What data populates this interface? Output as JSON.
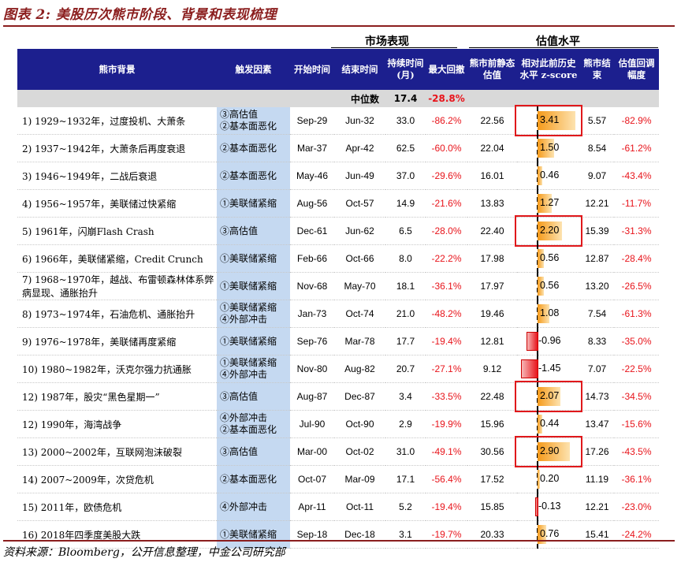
{
  "title": "图表 2: 美股历次熊市阶段、背景和表现梳理",
  "group_headers": {
    "market": "市场表现",
    "valuation": "估值水平"
  },
  "headers": [
    "熊市背景",
    "触发因素",
    "开始时间",
    "结束时间",
    "持续时间(月)",
    "最大回撤",
    "熊市前静态估值",
    "相对此前历史水平 z-score",
    "熊市结束",
    "估值回调幅度"
  ],
  "median": {
    "label": "中位数",
    "duration": "17.4",
    "drawdown": "-28.8%"
  },
  "rows": [
    {
      "bg": "1) 1929~1932年，过度投机、大萧条",
      "trigger": [
        "③高估值",
        "②基本面恶化"
      ],
      "start": "Sep-29",
      "end": "Jun-32",
      "dur": "33.0",
      "dd": "-86.2%",
      "pe_before": "22.56",
      "z": "3.41",
      "pe_end": "5.57",
      "pe_chg": "-82.9%",
      "z_value": 3.41,
      "highlight": true
    },
    {
      "bg": "2) 1937~1942年，大萧条后再度衰退",
      "trigger": [
        "②基本面恶化"
      ],
      "start": "Mar-37",
      "end": "Apr-42",
      "dur": "62.5",
      "dd": "-60.0%",
      "pe_before": "22.04",
      "z": "1.50",
      "pe_end": "8.54",
      "pe_chg": "-61.2%",
      "z_value": 1.5,
      "highlight": false
    },
    {
      "bg": "3) 1946~1949年，二战后衰退",
      "trigger": [
        "②基本面恶化"
      ],
      "start": "May-46",
      "end": "Jun-49",
      "dur": "37.0",
      "dd": "-29.6%",
      "pe_before": "16.01",
      "z": "0.46",
      "pe_end": "9.07",
      "pe_chg": "-43.4%",
      "z_value": 0.46,
      "highlight": false
    },
    {
      "bg": "4) 1956~1957年，美联储过快紧缩",
      "trigger": [
        "①美联储紧缩"
      ],
      "start": "Aug-56",
      "end": "Oct-57",
      "dur": "14.9",
      "dd": "-21.6%",
      "pe_before": "13.83",
      "z": "1.27",
      "pe_end": "12.21",
      "pe_chg": "-11.7%",
      "z_value": 1.27,
      "highlight": false
    },
    {
      "bg": "5) 1961年，闪崩Flash Crash",
      "trigger": [
        "③高估值"
      ],
      "start": "Dec-61",
      "end": "Jun-62",
      "dur": "6.5",
      "dd": "-28.0%",
      "pe_before": "22.40",
      "z": "2.20",
      "pe_end": "15.39",
      "pe_chg": "-31.3%",
      "z_value": 2.2,
      "highlight": true
    },
    {
      "bg": "6) 1966年，美联储紧缩，Credit Crunch",
      "trigger": [
        "①美联储紧缩"
      ],
      "start": "Feb-66",
      "end": "Oct-66",
      "dur": "8.0",
      "dd": "-22.2%",
      "pe_before": "17.98",
      "z": "0.56",
      "pe_end": "12.87",
      "pe_chg": "-28.4%",
      "z_value": 0.56,
      "highlight": false
    },
    {
      "bg": "7) 1968~1970年，越战、布雷顿森林体系弊病显现、通胀抬升",
      "trigger": [
        "①美联储紧缩"
      ],
      "start": "Nov-68",
      "end": "May-70",
      "dur": "18.1",
      "dd": "-36.1%",
      "pe_before": "17.97",
      "z": "0.56",
      "pe_end": "13.20",
      "pe_chg": "-26.5%",
      "z_value": 0.56,
      "highlight": false
    },
    {
      "bg": "8) 1973~1974年，石油危机、通胀抬升",
      "trigger": [
        "①美联储紧缩",
        "④外部冲击"
      ],
      "start": "Jan-73",
      "end": "Oct-74",
      "dur": "21.0",
      "dd": "-48.2%",
      "pe_before": "19.46",
      "z": "1.08",
      "pe_end": "7.54",
      "pe_chg": "-61.3%",
      "z_value": 1.08,
      "highlight": false
    },
    {
      "bg": "9) 1976~1978年，美联储再度紧缩",
      "trigger": [
        "①美联储紧缩"
      ],
      "start": "Sep-76",
      "end": "Mar-78",
      "dur": "17.7",
      "dd": "-19.4%",
      "pe_before": "12.81",
      "z": "-0.96",
      "pe_end": "8.33",
      "pe_chg": "-35.0%",
      "z_value": -0.96,
      "highlight": false
    },
    {
      "bg": "10) 1980~1982年，沃克尔强力抗通胀",
      "trigger": [
        "①美联储紧缩",
        "④外部冲击"
      ],
      "start": "Nov-80",
      "end": "Aug-82",
      "dur": "20.7",
      "dd": "-27.1%",
      "pe_before": "9.12",
      "z": "-1.45",
      "pe_end": "7.07",
      "pe_chg": "-22.5%",
      "z_value": -1.45,
      "highlight": false
    },
    {
      "bg": "12) 1987年，股灾“黑色星期一”",
      "trigger": [
        "③高估值"
      ],
      "start": "Aug-87",
      "end": "Dec-87",
      "dur": "3.4",
      "dd": "-33.5%",
      "pe_before": "22.48",
      "z": "2.07",
      "pe_end": "14.73",
      "pe_chg": "-34.5%",
      "z_value": 2.07,
      "highlight": true
    },
    {
      "bg": "12) 1990年，海湾战争",
      "trigger": [
        "④外部冲击",
        "②基本面恶化"
      ],
      "start": "Jul-90",
      "end": "Oct-90",
      "dur": "2.9",
      "dd": "-19.9%",
      "pe_before": "15.96",
      "z": "0.44",
      "pe_end": "13.47",
      "pe_chg": "-15.6%",
      "z_value": 0.44,
      "highlight": false
    },
    {
      "bg": "13) 2000~2002年，互联网泡沫破裂",
      "trigger": [
        "③高估值"
      ],
      "start": "Mar-00",
      "end": "Oct-02",
      "dur": "31.0",
      "dd": "-49.1%",
      "pe_before": "30.56",
      "z": "2.90",
      "pe_end": "17.26",
      "pe_chg": "-43.5%",
      "z_value": 2.9,
      "highlight": true
    },
    {
      "bg": "14) 2007~2009年，次贷危机",
      "trigger": [
        "②基本面恶化"
      ],
      "start": "Oct-07",
      "end": "Mar-09",
      "dur": "17.1",
      "dd": "-56.4%",
      "pe_before": "17.52",
      "z": "0.20",
      "pe_end": "11.19",
      "pe_chg": "-36.1%",
      "z_value": 0.2,
      "highlight": false
    },
    {
      "bg": "15) 2011年，欧债危机",
      "trigger": [
        "④外部冲击"
      ],
      "start": "Apr-11",
      "end": "Oct-11",
      "dur": "5.2",
      "dd": "-19.4%",
      "pe_before": "15.85",
      "z": "-0.13",
      "pe_end": "12.21",
      "pe_chg": "-23.0%",
      "z_value": -0.13,
      "highlight": false
    },
    {
      "bg": "16) 2018年四季度美股大跌",
      "trigger": [
        "①美联储紧缩"
      ],
      "start": "Sep-18",
      "end": "Dec-18",
      "dur": "3.1",
      "dd": "-19.7%",
      "pe_before": "20.33",
      "z": "0.76",
      "pe_end": "15.41",
      "pe_chg": "-24.2%",
      "z_value": 0.76,
      "highlight": false
    }
  ],
  "footer": "资料来源：Bloomberg，公开信息整理，中金公司研究部",
  "colors": {
    "header_bg": "#1c1f8e",
    "trigger_bg": "#c5d9f1",
    "negative": "#e8141b",
    "title": "#8b1e1e",
    "bar_positive": "#f59a1a",
    "highlight_box": "#e0181b"
  }
}
